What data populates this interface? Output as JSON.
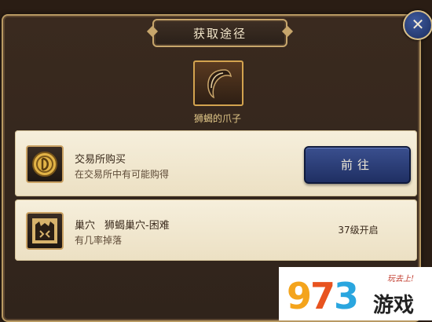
{
  "dialog": {
    "title": "获取途径",
    "close_symbol": "✕"
  },
  "item": {
    "name": "狮蝎的爪子",
    "icon": "claw-icon"
  },
  "sources": [
    {
      "icon": "coin-icon",
      "title": "交易所购买",
      "subtitle": "",
      "description": "在交易所中有可能购得",
      "action_label": "前往"
    },
    {
      "icon": "lair-icon",
      "title": "巢穴",
      "subtitle": "狮蝎巢穴-困难",
      "description": "有几率掉落",
      "requirement": "37级开启"
    }
  ],
  "watermark": {
    "digits": [
      "9",
      "7",
      "3"
    ],
    "name": "游戏",
    "tagline": "玩去上!"
  },
  "colors": {
    "panel": "#30241b",
    "gold_border": "#c7a66c",
    "row_bg": "#f6efdc",
    "button": "#2b3f7a"
  }
}
